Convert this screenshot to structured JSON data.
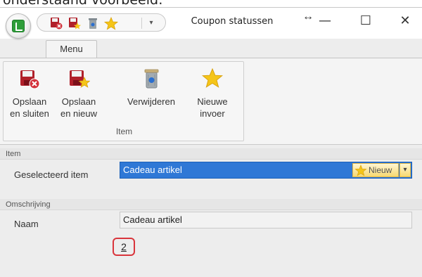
{
  "caption": "onderstaand voorbeeld:",
  "titlebar": {
    "title": "Coupon statussen",
    "resize_glyph": "↔",
    "minimize": "—",
    "maximize": "☐",
    "close": "✕"
  },
  "quick_access": {
    "icons": [
      "save-close-icon",
      "save-new-icon",
      "delete-icon",
      "star-icon"
    ],
    "dropdown_glyph": "▾"
  },
  "ribbon": {
    "tab_label": "Menu",
    "group_label": "Item",
    "buttons": [
      {
        "label_line1": "Opslaan",
        "label_line2": "en sluiten",
        "icon": "save-close-icon"
      },
      {
        "label_line1": "Opslaan",
        "label_line2": "en nieuw",
        "icon": "save-new-icon"
      },
      {
        "label_line1": "Verwijderen",
        "label_line2": "",
        "icon": "delete-icon"
      },
      {
        "label_line1": "Nieuwe",
        "label_line2": "invoer",
        "icon": "star-icon"
      }
    ]
  },
  "item_section": {
    "header": "Item",
    "selected_label": "Geselecteerd item",
    "selected_value": "Cadeau artikel",
    "new_button": "Nieuw",
    "dropdown_glyph": "▾"
  },
  "description_section": {
    "header": "Omschrijving",
    "name_label": "Naam",
    "name_value": "Cadeau artikel"
  },
  "marker": {
    "label": "2",
    "color": "#d9353c"
  },
  "colors": {
    "accent": "#2f78d6",
    "ribbon_bg": "#f4f4f4",
    "window_bg": "#ededed"
  }
}
